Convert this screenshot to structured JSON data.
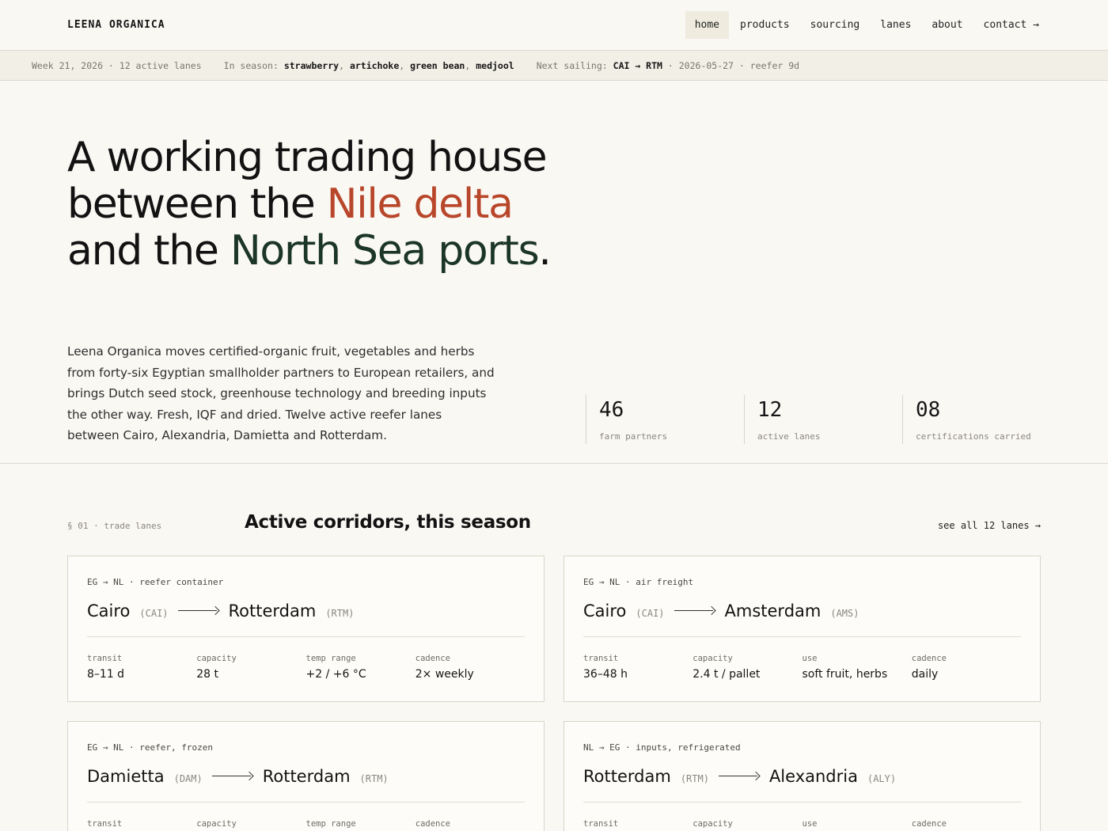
{
  "brand": "LEENA ORGANICA",
  "nav": [
    {
      "label": "home",
      "active": true
    },
    {
      "label": "products"
    },
    {
      "label": "sourcing"
    },
    {
      "label": "lanes"
    },
    {
      "label": "about"
    },
    {
      "label": "contact →"
    }
  ],
  "ticker": {
    "week": "Week 21, 2026 · 12 active lanes",
    "in_season_label": "In season:",
    "in_season": [
      "strawberry",
      "artichoke",
      "green bean",
      "medjool"
    ],
    "next_sailing_label": "Next sailing:",
    "next_sailing_route": "CAI → RTM",
    "next_sailing_detail": "· 2026-05-27 · reefer 9d"
  },
  "hero": {
    "title_part1": "A working trading house between the ",
    "title_highlight1": "Nile delta",
    "title_part2": " and the ",
    "title_highlight2": "North Sea ports",
    "title_end": ".",
    "body": "Leena Organica moves certified-organic fruit, vegetables and herbs from forty-six Egyptian smallholder partners to European retailers, and brings Dutch seed stock, greenhouse technology and breeding inputs the other way. Fresh, IQF and dried. Twelve active reefer lanes between Cairo, Alexandria, Damietta and Rotterdam.",
    "stats": [
      {
        "num": "46",
        "label": "farm partners"
      },
      {
        "num": "12",
        "label": "active lanes"
      },
      {
        "num": "08",
        "label": "certifications carried"
      }
    ]
  },
  "lanes": {
    "section_label": "§ 01 · trade lanes",
    "title": "Active corridors, this season",
    "link": "see all 12 lanes →",
    "cards": [
      {
        "kicker": "EG → NL · reefer container",
        "from": "Cairo",
        "from_code": "(CAI)",
        "to": "Rotterdam",
        "to_code": "(RTM)",
        "specs": [
          {
            "k": "transit",
            "v": "8–11 d"
          },
          {
            "k": "capacity",
            "v": "28 t"
          },
          {
            "k": "temp range",
            "v": "+2 / +6 °C"
          },
          {
            "k": "cadence",
            "v": "2× weekly"
          }
        ]
      },
      {
        "kicker": "EG → NL · air freight",
        "from": "Cairo",
        "from_code": "(CAI)",
        "to": "Amsterdam",
        "to_code": "(AMS)",
        "specs": [
          {
            "k": "transit",
            "v": "36–48 h"
          },
          {
            "k": "capacity",
            "v": "2.4 t / pallet"
          },
          {
            "k": "use",
            "v": "soft fruit, herbs"
          },
          {
            "k": "cadence",
            "v": "daily"
          }
        ]
      },
      {
        "kicker": "EG → NL · reefer, frozen",
        "from": "Damietta",
        "from_code": "(DAM)",
        "to": "Rotterdam",
        "to_code": "(RTM)",
        "specs": [
          {
            "k": "transit",
            "v": ""
          },
          {
            "k": "capacity",
            "v": ""
          },
          {
            "k": "temp range",
            "v": ""
          },
          {
            "k": "cadence",
            "v": ""
          }
        ]
      },
      {
        "kicker": "NL → EG · inputs, refrigerated",
        "from": "Rotterdam",
        "from_code": "(RTM)",
        "to": "Alexandria",
        "to_code": "(ALY)",
        "specs": [
          {
            "k": "transit",
            "v": ""
          },
          {
            "k": "capacity",
            "v": ""
          },
          {
            "k": "use",
            "v": ""
          },
          {
            "k": "cadence",
            "v": ""
          }
        ]
      }
    ]
  }
}
